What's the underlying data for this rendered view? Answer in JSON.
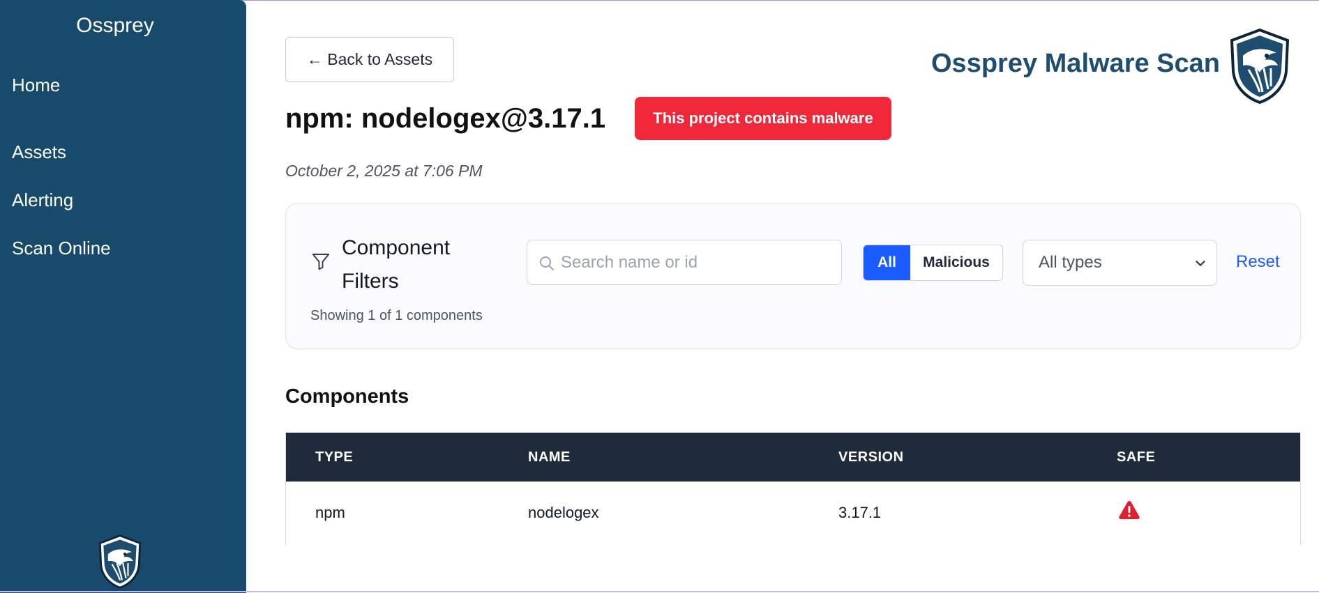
{
  "sidebar": {
    "brand": "Ossprey",
    "items": [
      {
        "label": "Home"
      },
      {
        "label": "Assets"
      },
      {
        "label": "Alerting"
      },
      {
        "label": "Scan Online"
      }
    ],
    "logo_icon": "eagle-shield-icon"
  },
  "header": {
    "back_label": "← Back to Assets",
    "title": "Ossprey Malware Scan",
    "logo_icon": "eagle-shield-icon"
  },
  "project": {
    "title": "npm: nodelogex@3.17.1",
    "badge": "This project contains malware",
    "date": "October 2, 2025 at 7:06 PM"
  },
  "filters": {
    "heading": "Component Filters",
    "showing": "Showing 1 of 1 components",
    "search_placeholder": "Search name or id",
    "search_value": "",
    "segment_all": "All",
    "segment_malicious": "Malicious",
    "type_selected": "All types",
    "reset": "Reset"
  },
  "components": {
    "heading": "Components",
    "columns": [
      "TYPE",
      "NAME",
      "VERSION",
      "SAFE"
    ],
    "rows": [
      {
        "type": "npm",
        "name": "nodelogex",
        "version": "3.17.1",
        "safe_icon": "warning-icon"
      }
    ]
  },
  "colors": {
    "sidebar_bg": "#174a6b",
    "brand_text": "#1e4d6f",
    "badge_red": "#f0283a",
    "accent_blue": "#1a5cff",
    "table_header_bg": "#1f2a3a"
  }
}
